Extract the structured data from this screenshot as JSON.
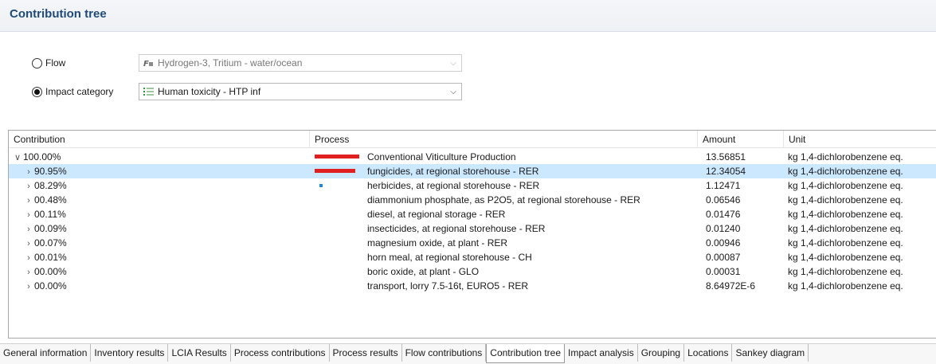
{
  "header": {
    "title": "Contribution tree"
  },
  "selector": {
    "flow_label": "Flow",
    "flow_value": "Hydrogen-3, Tritium - water/ocean",
    "flow_icon": "flow-icon",
    "impact_label": "Impact category",
    "impact_value": "Human toxicity - HTP inf",
    "impact_icon": "impact-category-icon",
    "selected": "impact"
  },
  "tree": {
    "columns": [
      "Contribution",
      "Process",
      "Amount",
      "Unit"
    ],
    "rows": [
      {
        "contribution": "100.00%",
        "expanded": true,
        "process": "Conventional Viticulture Production",
        "amount": "13.56851",
        "unit": "kg 1,4-dichlorobenzene eq.",
        "bar": 1.0
      },
      {
        "contribution": "90.95%",
        "expanded": false,
        "process": "fungicides, at regional storehouse - RER",
        "amount": "12.34054",
        "unit": "kg 1,4-dichlorobenzene eq.",
        "bar": 0.9095,
        "selected": true
      },
      {
        "contribution": "08.29%",
        "expanded": false,
        "process": "herbicides, at regional storehouse - RER",
        "amount": "1.12471",
        "unit": "kg 1,4-dichlorobenzene eq.",
        "bar": 0.0829
      },
      {
        "contribution": "00.48%",
        "expanded": false,
        "process": "diammonium phosphate, as P2O5, at regional storehouse - RER",
        "amount": "0.06546",
        "unit": "kg 1,4-dichlorobenzene eq.",
        "bar": 0.0048
      },
      {
        "contribution": "00.11%",
        "expanded": false,
        "process": "diesel, at regional storage - RER",
        "amount": "0.01476",
        "unit": "kg 1,4-dichlorobenzene eq.",
        "bar": 0.0011
      },
      {
        "contribution": "00.09%",
        "expanded": false,
        "process": "insecticides, at regional storehouse - RER",
        "amount": "0.01240",
        "unit": "kg 1,4-dichlorobenzene eq.",
        "bar": 0.0009
      },
      {
        "contribution": "00.07%",
        "expanded": false,
        "process": "magnesium oxide, at plant - RER",
        "amount": "0.00946",
        "unit": "kg 1,4-dichlorobenzene eq.",
        "bar": 0.0007
      },
      {
        "contribution": "00.01%",
        "expanded": false,
        "process": "horn meal, at regional storehouse - CH",
        "amount": "0.00087",
        "unit": "kg 1,4-dichlorobenzene eq.",
        "bar": 0.0001
      },
      {
        "contribution": "00.00%",
        "expanded": false,
        "process": "boric oxide, at plant - GLO",
        "amount": "0.00031",
        "unit": "kg 1,4-dichlorobenzene eq.",
        "bar": 0.0
      },
      {
        "contribution": "00.00%",
        "expanded": false,
        "process": "transport, lorry 7.5-16t, EURO5 - RER",
        "amount": "8.64972E-6",
        "unit": "kg 1,4-dichlorobenzene eq.",
        "bar": 0.0
      }
    ]
  },
  "tabs": [
    {
      "label": "General information"
    },
    {
      "label": "Inventory results"
    },
    {
      "label": "LCIA Results"
    },
    {
      "label": "Process contributions"
    },
    {
      "label": "Process results"
    },
    {
      "label": "Flow contributions"
    },
    {
      "label": "Contribution tree",
      "active": true
    },
    {
      "label": "Impact analysis"
    },
    {
      "label": "Grouping"
    },
    {
      "label": "Locations"
    },
    {
      "label": "Sankey diagram"
    }
  ],
  "colors": {
    "title": "#1f4a7a",
    "selection": "#cce8ff",
    "bar_major": "#e02020",
    "bar_minor": "#1e88e5"
  }
}
